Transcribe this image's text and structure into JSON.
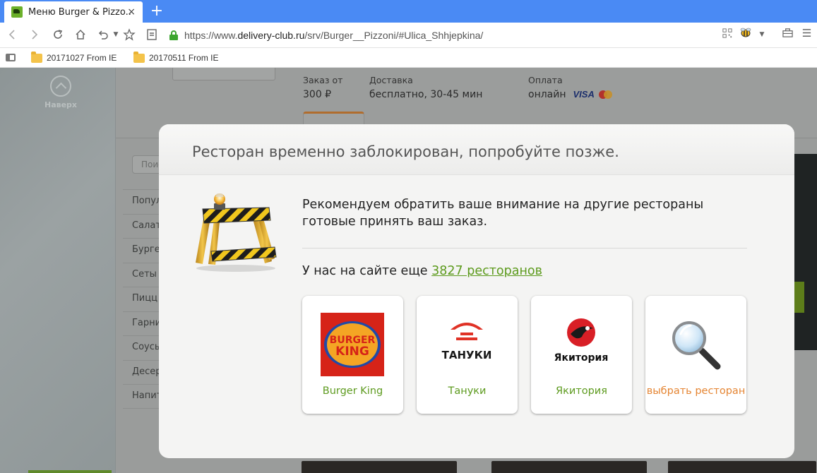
{
  "browser": {
    "tab_title": "Меню Burger & Pizzo...",
    "tab_close": "×",
    "new_tab": "+",
    "url_prefix": "https://www.",
    "url_domain": "delivery-club.ru",
    "url_path": "/srv/Burger__Pizzoni/#Ulica_Shhjepkina/",
    "bookmarks": [
      {
        "label": "20171027 From IE"
      },
      {
        "label": "20170511 From IE"
      }
    ]
  },
  "page": {
    "scroll_top_label": "Наверх",
    "header": {
      "min_order_label": "Заказ от",
      "min_order_value": "300 ₽",
      "delivery_label": "Доставка",
      "delivery_value": "бесплатно, 30-45 мин",
      "payment_label": "Оплата",
      "payment_value": "онлайн",
      "visa_label": "VISA"
    },
    "search_placeholder": "Поиск",
    "menu_categories": [
      "Попул",
      "Салат",
      "Бурге",
      "Сеты",
      "Пицц",
      "Гарни",
      "Соусы",
      "Десер",
      "Напит"
    ]
  },
  "modal": {
    "title": "Ресторан временно заблокирован, попробуйте позже.",
    "recommend_line1": "Рекомендуем обратить ваше внимание на другие рестораны",
    "recommend_line2": "готовые принять ваш заказ.",
    "count_prefix": "У нас на сайте еще ",
    "count_link": "3827 ресторанов",
    "cards": [
      {
        "name": "Burger King",
        "logo_text_top": "BURGER",
        "logo_text_bottom": "KING"
      },
      {
        "name": "Тануки",
        "logo_text": "ТАНУКИ"
      },
      {
        "name": "Якитория",
        "logo_text": "Якитория"
      },
      {
        "name": "выбрать ресторан"
      }
    ]
  },
  "colors": {
    "browser_blue": "#4a8af4",
    "link_green": "#5c9a1c",
    "choose_orange": "#e58533",
    "bk_red": "#d62318"
  }
}
